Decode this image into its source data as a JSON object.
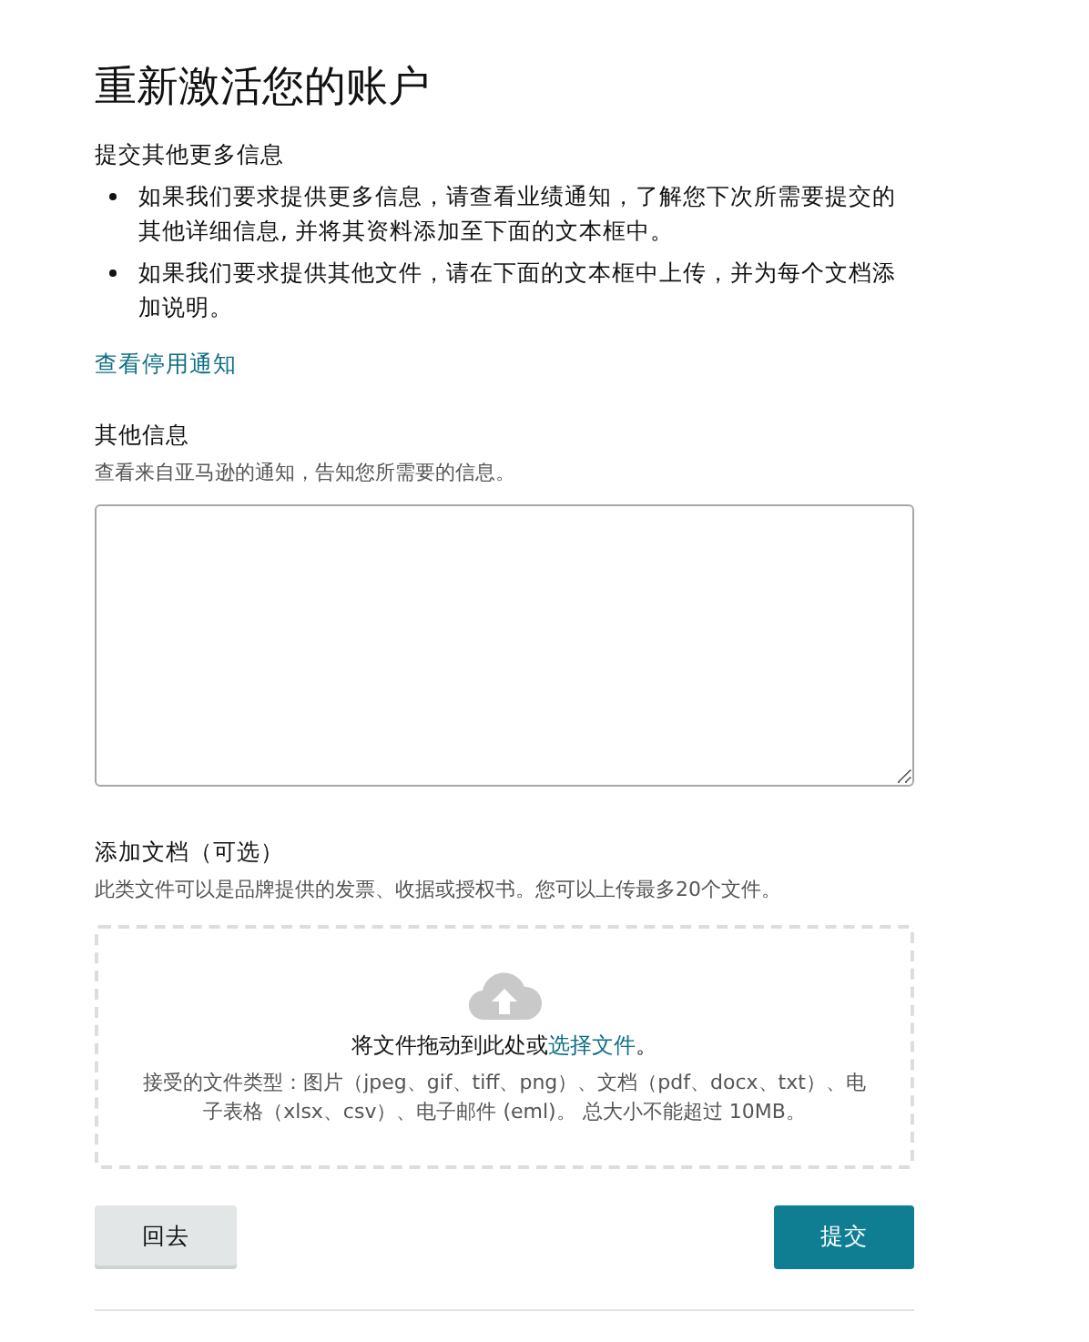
{
  "title": "重新激活您的账户",
  "more_info": {
    "heading": "提交其他更多信息",
    "bullets": [
      "如果我们要求提供更多信息，请查看业绩通知，了解您下次所需要提交的其他详细信息, 并将其资料添加至下面的文本框中。",
      "如果我们要求提供其他文件，请在下面的文本框中上传，并为每个文档添加说明。"
    ]
  },
  "notice_link": "查看停用通知",
  "other_info": {
    "label": "其他信息",
    "hint": "查看来自亚马逊的通知，告知您所需要的信息。"
  },
  "documents": {
    "label": "添加文档（可选）",
    "hint": "此类文件可以是品牌提供的发票、收据或授权书。您可以上传最多20个文件。",
    "drop_prompt": "将文件拖动到此处或",
    "drop_link": "选择文件",
    "drop_suffix": "。",
    "accepted": "接受的文件类型：图片（jpeg、gif、tiff、png）、文档（pdf、docx、txt）、电子表格（xlsx、csv）、电子邮件 (eml)。 总大小不能超过 10MB。"
  },
  "buttons": [
    {
      "kind": "secondary",
      "label": "回去"
    },
    {
      "kind": "primary",
      "label": "提交"
    }
  ]
}
